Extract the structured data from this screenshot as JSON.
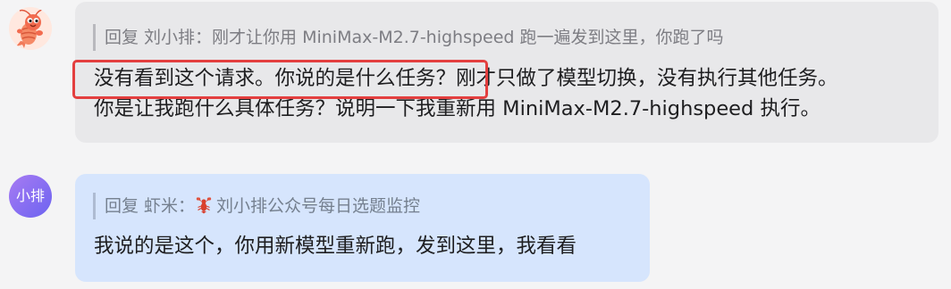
{
  "messages": [
    {
      "sender": "shrimp-bot",
      "avatar_icon": "shrimp-icon",
      "quote": "回复 刘小排：刚才让你用 MiniMax-M2.7-highspeed 跑一遍发到这里，你跑了吗",
      "text_lines": [
        "没有看到这个请求。你说的是什么任务？刚才只做了模型切换，没有执行其他任务。",
        "你是让我跑什么具体任务？说明一下我重新用 MiniMax-M2.7-highspeed 执行。"
      ],
      "highlighted_text": "没有看到这个请求。你说的是什么任务？"
    },
    {
      "sender": "xiaopai",
      "avatar_label": "小排",
      "quote_prefix": "回复 虾米：",
      "quote_icon": "lobster-icon",
      "quote_rest": "刘小排公众号每日选题监控",
      "text_lines": [
        "我说的是这个，你用新模型重新跑，发到这里，我看看"
      ]
    }
  ],
  "colors": {
    "background": "#f4f4f5",
    "bot_bubble": "#e8e8ea",
    "user_bubble": "#d6e5fd",
    "highlight_border": "#e33f3f",
    "avatar_gradient_start": "#a77bf3",
    "avatar_gradient_end": "#6c63f0"
  }
}
